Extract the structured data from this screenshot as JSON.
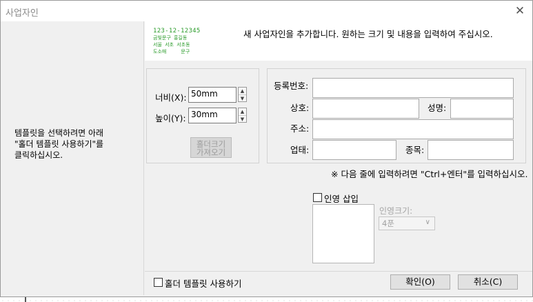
{
  "window": {
    "title": "사업자인"
  },
  "hint": "템플릿을 선택하려면 아래\n\"홀더 템플릿 사용하기\"를\n클릭하십시오.",
  "header": {
    "logo_lines": [
      "123-12-12345",
      "금빛문구 홍길동",
      "서울 서초 서초동",
      "도소매     문구"
    ],
    "instruction": "새 사업자인을 추가합니다.  원하는 크기 및 내용을 입력하여 주십시오."
  },
  "size": {
    "width_label": "너비(X):",
    "width_value": "50mm",
    "height_label": "높이(Y):",
    "height_value": "30mm",
    "holder_button": "홀더크기\n가져오기"
  },
  "business": {
    "reg_no_label": "등록번호:",
    "company_label": "상호:",
    "name_label": "성명:",
    "address_label": "주소:",
    "type_label": "업태:",
    "item_label": "종목:",
    "reg_no": "",
    "company": "",
    "name": "",
    "address": "",
    "type": "",
    "item": ""
  },
  "note": "※ 다음 줄에 입력하려면 \"Ctrl+엔터\"를 입력하십시오.",
  "seal": {
    "insert_label": "인영 삽입",
    "insert_checked": false,
    "size_label": "인영크기:",
    "size_value": "4푼"
  },
  "footer": {
    "use_template_label": "홀더 템플릿 사용하기",
    "use_template_checked": false,
    "ok": "확인(O)",
    "cancel": "취소(C)"
  }
}
